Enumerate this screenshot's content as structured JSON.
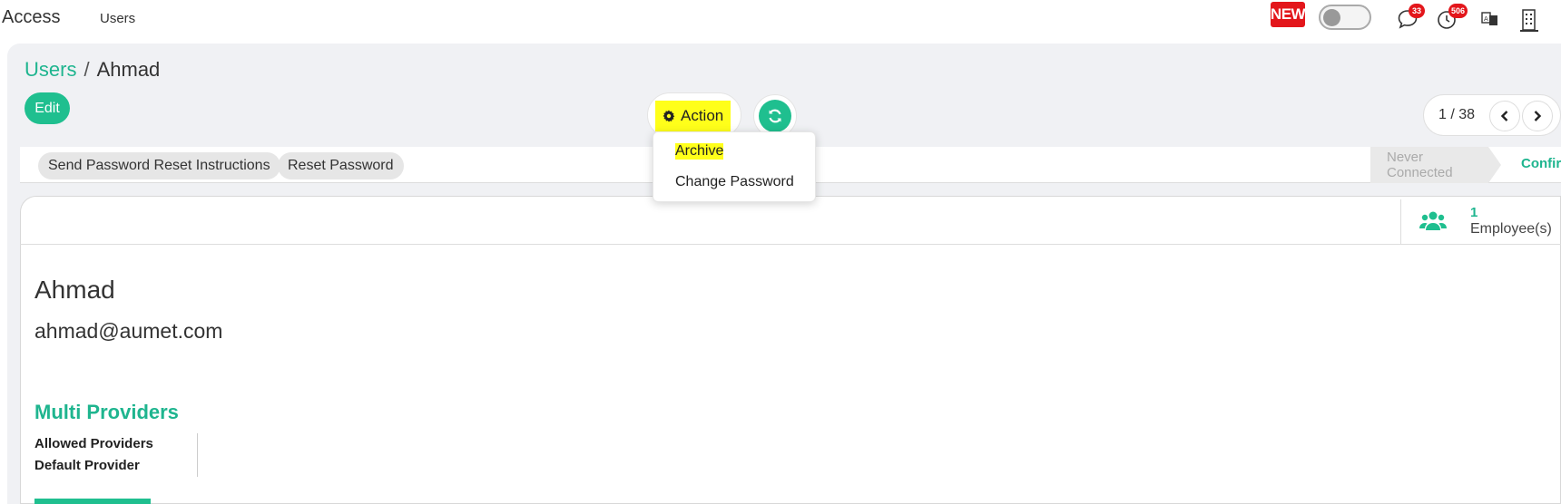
{
  "topbar": {
    "app_title": "Access",
    "nav_item": "Users",
    "new_badge": "NEW",
    "messages_count": "33",
    "activities_count": "506"
  },
  "breadcrumb": {
    "parent": "Users",
    "separator": "/",
    "current": "Ahmad"
  },
  "control": {
    "edit_label": "Edit",
    "action_label": "Action",
    "pager": "1 / 38"
  },
  "action_menu": {
    "items": [
      "Archive",
      "Change Password"
    ]
  },
  "header_buttons": [
    "Send Password Reset Instructions",
    "Reset Password"
  ],
  "status": {
    "never_connected": "Never Connected",
    "confirmed": "Confirm"
  },
  "smart_button": {
    "value": "1",
    "label": "Employee(s)"
  },
  "user": {
    "name": "Ahmad",
    "email": "ahmad@aumet.com"
  },
  "section": {
    "title": "Multi Providers",
    "fields": [
      "Allowed Providers",
      "Default Provider"
    ]
  },
  "colors": {
    "accent": "#1fbf8f",
    "highlight": "#ffff1a",
    "badge": "#e3161b"
  }
}
